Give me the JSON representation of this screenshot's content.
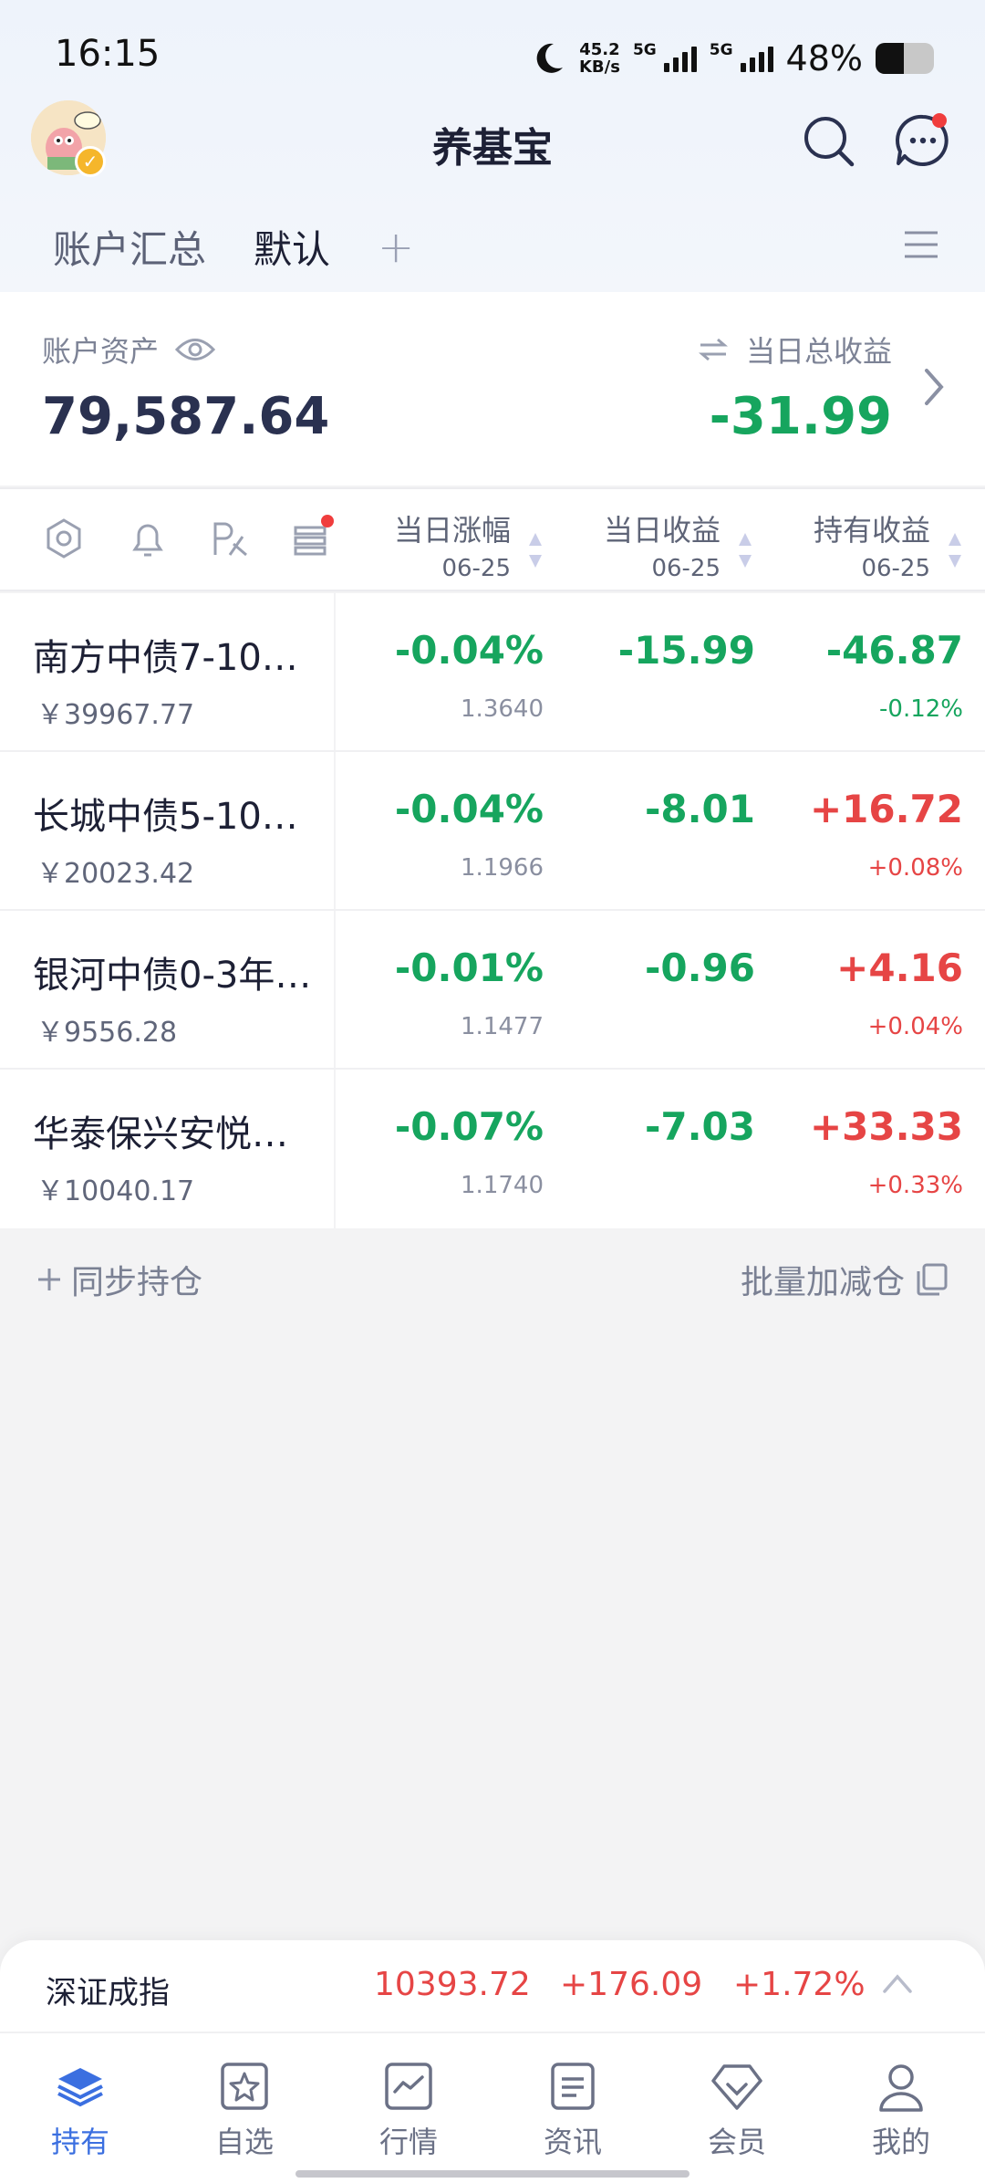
{
  "status_bar": {
    "time": "16:15",
    "net_speed_value": "45.2",
    "net_speed_unit": "KB/s",
    "sim1_label": "5G",
    "sim2_label": "5G",
    "battery_text": "48%",
    "battery_level": 0.48,
    "icons": [
      "moon-icon",
      "signal-icon",
      "battery-icon"
    ]
  },
  "header": {
    "title": "养基宝",
    "icons": [
      "avatar",
      "search-icon",
      "message-icon"
    ]
  },
  "tabs": {
    "summary": "账户汇总",
    "default": "默认",
    "add": "+"
  },
  "account": {
    "asset_label": "账户资产",
    "asset_value": "79,587.64",
    "daily_pl_label": "当日总收益",
    "daily_pl_value": "-31.99"
  },
  "table_header": {
    "col_change": "当日涨幅",
    "col_change_date": "06-25",
    "col_daily_pl": "当日收益",
    "col_daily_pl_date": "06-25",
    "col_hold_pl": "持有收益",
    "col_hold_pl_date": "06-25",
    "icons": [
      "settings-icon",
      "bell-icon",
      "compare-icon",
      "list-icon"
    ]
  },
  "funds": [
    {
      "name": "南方中债7-10…",
      "amount": "￥39967.77",
      "change": "-0.04%",
      "nav": "1.3640",
      "daily_pl": "-15.99",
      "hold_pl": "-46.87",
      "hold_pl_pct": "-0.12%"
    },
    {
      "name": "长城中债5-10…",
      "amount": "￥20023.42",
      "change": "-0.04%",
      "nav": "1.1966",
      "daily_pl": "-8.01",
      "hold_pl": "+16.72",
      "hold_pl_pct": "+0.08%"
    },
    {
      "name": "银河中债0-3年…",
      "amount": "￥9556.28",
      "change": "-0.01%",
      "nav": "1.1477",
      "daily_pl": "-0.96",
      "hold_pl": "+4.16",
      "hold_pl_pct": "+0.04%"
    },
    {
      "name": "华泰保兴安悦…",
      "amount": "￥10040.17",
      "change": "-0.07%",
      "nav": "1.1740",
      "daily_pl": "-7.03",
      "hold_pl": "+33.33",
      "hold_pl_pct": "+0.33%"
    }
  ],
  "actions": {
    "sync_holdings": "同步持仓",
    "batch_adjust": "批量加减仓"
  },
  "index_ticker": {
    "name": "深证成指",
    "value": "10393.72",
    "change": "+176.09",
    "change_pct": "+1.72%"
  },
  "bottom_nav": {
    "hold": "持有",
    "watchlist": "自选",
    "market": "行情",
    "news": "资讯",
    "member": "会员",
    "mine": "我的"
  },
  "colors": {
    "accent": "#3b6fe0",
    "up_red": "#e64545",
    "down_green": "#16a55e"
  }
}
